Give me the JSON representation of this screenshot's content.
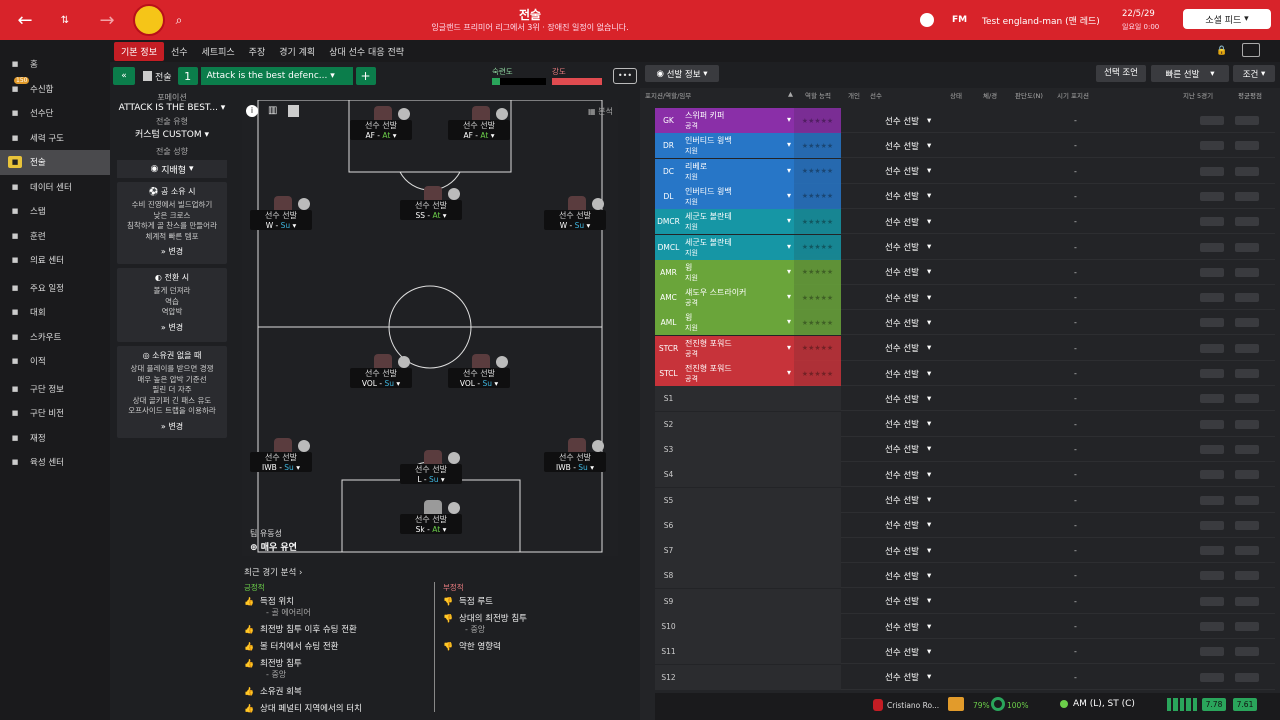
{
  "topbar": {
    "title": "전술",
    "subtitle": "잉글랜드 프리미어 리그에서 3위 · 장애진 일정이 없습니다.",
    "fm": "FM",
    "manager": "Test england-man (맨 레드)",
    "date": "22/5/29",
    "time": "일요일 0:00",
    "social": "소셜 피드"
  },
  "subnav": [
    "기본 정보",
    "선수",
    "세트피스",
    "주장",
    "경기 계획",
    "상대 선수 대응 전략"
  ],
  "sidebar": [
    {
      "label": "홈",
      "icon": "home-icon"
    },
    {
      "label": "수신함",
      "icon": "inbox-icon",
      "badge": "150"
    },
    {
      "label": "선수단",
      "icon": "squad-icon"
    },
    {
      "label": "세력 구도",
      "icon": "dynamics-icon"
    },
    {
      "label": "전술",
      "icon": "tactics-icon",
      "active": true
    },
    {
      "label": "데이터 센터",
      "icon": "data-icon"
    },
    {
      "label": "스탭",
      "icon": "staff-icon"
    },
    {
      "label": "훈련",
      "icon": "training-icon"
    },
    {
      "label": "의료 센터",
      "icon": "medical-icon"
    },
    {
      "label": "주요 일정",
      "icon": "calendar-icon"
    },
    {
      "label": "대회",
      "icon": "trophy-icon"
    },
    {
      "label": "스카우트",
      "icon": "scout-icon"
    },
    {
      "label": "이적",
      "icon": "transfer-icon"
    },
    {
      "label": "구단 정보",
      "icon": "club-icon"
    },
    {
      "label": "구단 비전",
      "icon": "vision-icon"
    },
    {
      "label": "재정",
      "icon": "finance-icon"
    },
    {
      "label": "육성 센터",
      "icon": "dev-icon"
    }
  ],
  "toolbar": {
    "tactic_label": "전술",
    "slot": "1",
    "tactic_name": "Attack is the best defenc...",
    "familiarity": "숙련도",
    "intensity": "강도",
    "lineup_btn": "선발 정보",
    "choose_btn": "선택 조언",
    "quick_btn": "빠른 선발",
    "cond_btn": "조건"
  },
  "left_panel": {
    "formation_label": "포메이션",
    "formation": "ATTACK IS THE BEST...",
    "type_label": "전술 유형",
    "type": "커스텀 CUSTOM",
    "mentality_label": "전술 성향",
    "mentality": "지배형",
    "in_poss": {
      "title": "공 소유 시",
      "lines": [
        "수비 진영에서 빌드업하기",
        "낮은 크로스",
        "침착하게 골 찬스를 만들어라",
        "체계적 빠른 템포"
      ],
      "change": "변경"
    },
    "transition": {
      "title": "전환 시",
      "lines": [
        "볼게 던져라",
        "역습",
        "역압박"
      ],
      "change": "변경"
    },
    "out_poss": {
      "title": "소유권 없을 때",
      "lines": [
        "상대 플레이를 받으면 경쟁",
        "매우 높은 압박 기준선",
        "필린 더 자주",
        "상대 골키퍼 긴 패스 유도",
        "오프사이드 트랩을 이용하라"
      ],
      "change": "변경"
    }
  },
  "pitch": {
    "analysis_label": "분석",
    "fluidity_label": "팀 유동성",
    "fluidity": "매우 유연",
    "players": [
      {
        "name": "선수 선발",
        "role": "AF",
        "duty": "At",
        "cls": "at"
      },
      {
        "name": "선수 선발",
        "role": "AF",
        "duty": "At",
        "cls": "at"
      },
      {
        "name": "선수 선발",
        "role": "SS",
        "duty": "At",
        "cls": "at"
      },
      {
        "name": "선수 선발",
        "role": "W",
        "duty": "Su",
        "cls": "du"
      },
      {
        "name": "선수 선발",
        "role": "W",
        "duty": "Su",
        "cls": "du"
      },
      {
        "name": "선수 선발",
        "role": "VOL",
        "duty": "Su",
        "cls": "du"
      },
      {
        "name": "선수 선발",
        "role": "VOL",
        "duty": "Su",
        "cls": "du"
      },
      {
        "name": "선수 선발",
        "role": "IWB",
        "duty": "Su",
        "cls": "du"
      },
      {
        "name": "선수 선발",
        "role": "L",
        "duty": "Su",
        "cls": "du"
      },
      {
        "name": "선수 선발",
        "role": "IWB",
        "duty": "Su",
        "cls": "du"
      },
      {
        "name": "선수 선발",
        "role": "Sk",
        "duty": "At",
        "cls": "at"
      }
    ]
  },
  "analysis": {
    "title": "최근 경기 분석",
    "pos_label": "긍정적",
    "neg_label": "부정적",
    "positive": [
      {
        "t": "득점 위치",
        "sub": "골 에어리어"
      },
      {
        "t": "최전방 침투 이후 슈팅 전환"
      },
      {
        "t": "볼 터치에서 슈팅 전환"
      },
      {
        "t": "최전방 침투",
        "sub": "중앙"
      },
      {
        "t": "소유권 회복"
      },
      {
        "t": "상대 페널티 지역에서의 터치"
      }
    ],
    "negative": [
      {
        "t": "득점 루트"
      },
      {
        "t": "상대의 최전방 침투",
        "sub": "중앙"
      },
      {
        "t": "약한 영향력"
      }
    ]
  },
  "table": {
    "headers": {
      "pos": "포지션/역할/임무",
      "ability": "역할 능력",
      "ind": "개인",
      "player": "선수",
      "status": "상태",
      "fit": "체/경",
      "ratings": "판단도(N)",
      "pos2": "시기 포지션",
      "last5": "지난 5경기",
      "avg": "평균평점"
    },
    "select_label": "선수 선발",
    "dash": "-",
    "rows": [
      {
        "pos": "GK",
        "role": "스위퍼 키퍼",
        "duty": "공격",
        "color": "#8a2fa8"
      },
      {
        "pos": "DR",
        "role": "인버티드 윙백",
        "duty": "지원",
        "color": "#2776c7"
      },
      {
        "pos": "DC",
        "role": "리베로",
        "duty": "지원",
        "color": "#2776c7"
      },
      {
        "pos": "DL",
        "role": "인버티드 윙백",
        "duty": "지원",
        "color": "#2776c7"
      },
      {
        "pos": "DMCR",
        "role": "세군도 볼란테",
        "duty": "지원",
        "color": "#1696a5"
      },
      {
        "pos": "DMCL",
        "role": "세군도 볼란테",
        "duty": "지원",
        "color": "#1696a5"
      },
      {
        "pos": "AMR",
        "role": "윙",
        "duty": "지원",
        "color": "#6aa53a"
      },
      {
        "pos": "AMC",
        "role": "섀도우 스트라이커",
        "duty": "공격",
        "color": "#6aa53a"
      },
      {
        "pos": "AML",
        "role": "윙",
        "duty": "지원",
        "color": "#6aa53a"
      },
      {
        "pos": "STCR",
        "role": "전진형 포워드",
        "duty": "공격",
        "color": "#c7333a"
      },
      {
        "pos": "STCL",
        "role": "전진형 포워드",
        "duty": "공격",
        "color": "#c7333a"
      },
      {
        "pos": "S1"
      },
      {
        "pos": "S2"
      },
      {
        "pos": "S3"
      },
      {
        "pos": "S4"
      },
      {
        "pos": "S5"
      },
      {
        "pos": "S6"
      },
      {
        "pos": "S7"
      },
      {
        "pos": "S8"
      },
      {
        "pos": "S9"
      },
      {
        "pos": "S10"
      },
      {
        "pos": "S11"
      },
      {
        "pos": "S12"
      }
    ]
  },
  "bottombar": {
    "player": "Cristiano Ro...",
    "pct1": "79%",
    "pct2": "100%",
    "pos": "AM (L), ST (C)",
    "r1": "7.78",
    "r2": "7.61"
  }
}
